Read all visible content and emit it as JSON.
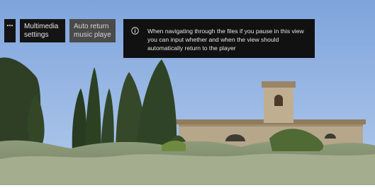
{
  "menu": {
    "items": [
      {
        "label": ""
      },
      {
        "label": "Multimedia\nsettings"
      },
      {
        "label": "Auto return\nmusic playe"
      }
    ]
  },
  "info_panel": {
    "icon": "info-icon",
    "text": "When navigating through the files if you pause in this view you can input whether and when the view should automatically return to the player"
  },
  "colors": {
    "tile_bg": "#141414",
    "tile_selected_bg": "#4a4a4a",
    "panel_bg": "#111111",
    "text": "#e6e6e6",
    "sky": "#7ea4dc"
  }
}
